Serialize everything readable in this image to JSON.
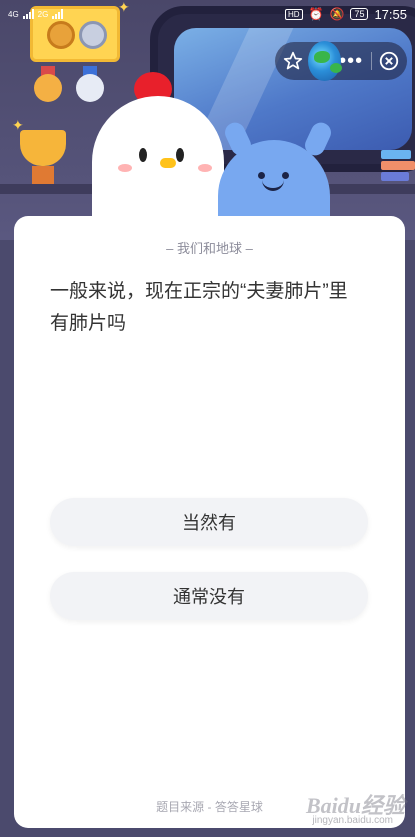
{
  "status_bar": {
    "network_1": "4G",
    "network_2": "2G",
    "hd_label": "HD",
    "battery": "75",
    "time": "17:55"
  },
  "capsule": {
    "star_icon": "star-outline-icon",
    "globe_icon": "globe-icon",
    "more_label": "•••",
    "close_icon": "close-circle-icon"
  },
  "card": {
    "topic": "– 我们和地球 –",
    "question": "一般来说，现在正宗的“夫妻肺片”里有肺片吗",
    "options": [
      "当然有",
      "通常没有"
    ],
    "source": "题目来源 - 答答星球"
  },
  "watermark": {
    "logo_text": "Baidu经验",
    "url": "jingyan.baidu.com"
  },
  "colors": {
    "scene_bg": "#4b4a6d",
    "card_bg": "#ffffff",
    "option_bg": "#f2f3f6",
    "text_primary": "#333333",
    "text_secondary": "#8c8c9a"
  }
}
